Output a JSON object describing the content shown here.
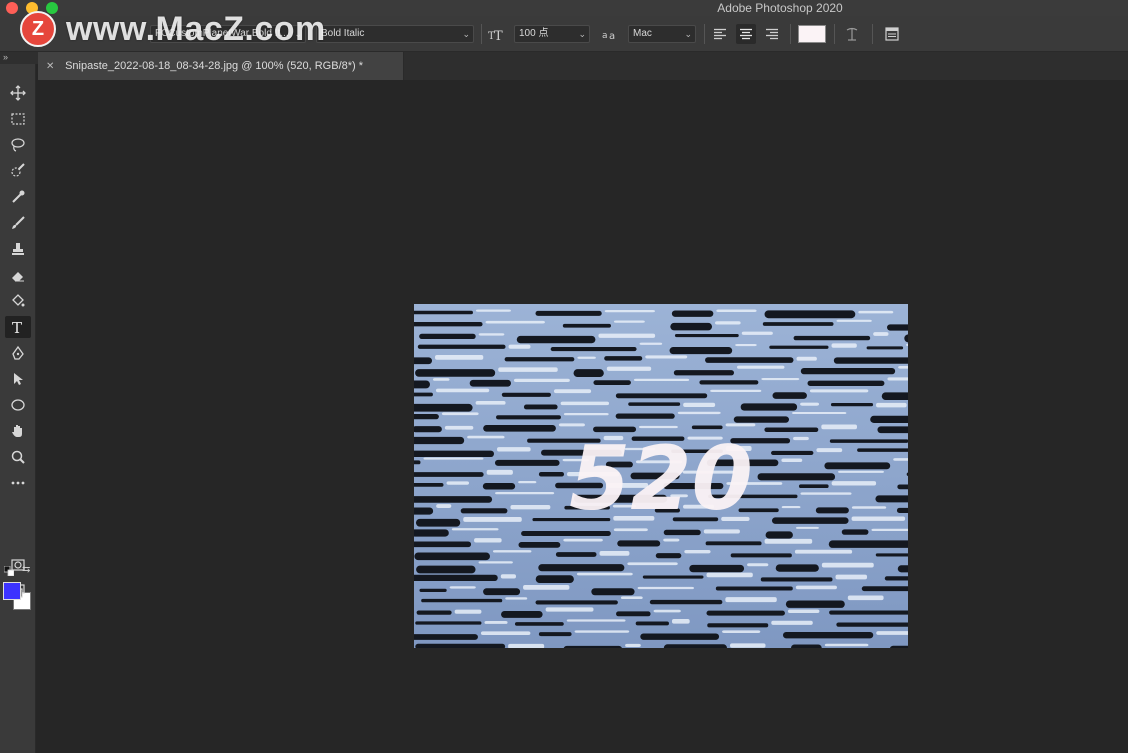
{
  "window": {
    "title": "Adobe Photoshop 2020"
  },
  "watermark": {
    "logo_letter": "Z",
    "text": "www.MacZ.com"
  },
  "options_bar": {
    "font_family": "FCCustomPlanetWar Bold It...",
    "font_style": "Bold Italic",
    "font_size": "100 点",
    "anti_alias": "Mac",
    "text_color": "#fbf3f6"
  },
  "document_tab": {
    "title": "Snipaste_2022-08-18_08-34-28.jpg @ 100% (520, RGB/8*) *"
  },
  "toolbox": {
    "foreground_color": "#3c33ff",
    "background_color": "#ffffff",
    "active_tool": "type-tool"
  },
  "canvas": {
    "text_layer": "520"
  }
}
